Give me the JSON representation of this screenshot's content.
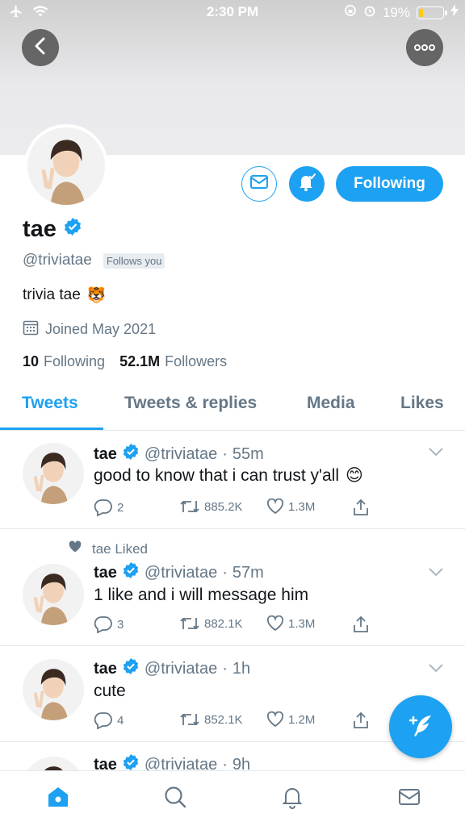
{
  "status_bar": {
    "time": "2:30 PM",
    "battery_percent": "19%",
    "battery_level": 0.19
  },
  "header": {
    "back_icon": "chevron-left-icon",
    "more_icon": "more-horizontal-icon"
  },
  "profile": {
    "name": "tae",
    "verified": true,
    "handle": "@triviatae",
    "follows_you": "Follows you",
    "bio": "trivia tae",
    "bio_emoji": "🐯",
    "joined": "Joined May 2021",
    "following_count": "10",
    "following_label": "Following",
    "followers_count": "52.1M",
    "followers_label": "Followers",
    "follow_button": "Following"
  },
  "tabs": [
    {
      "label": "Tweets",
      "active": true
    },
    {
      "label": "Tweets & replies",
      "active": false
    },
    {
      "label": "Media",
      "active": false
    },
    {
      "label": "Likes",
      "active": false
    }
  ],
  "tweets": [
    {
      "name": "tae",
      "handle": "@triviatae",
      "time": "55m",
      "text": "good to know that i can trust y'all",
      "emoji": "😊",
      "replies": "2",
      "retweets": "885.2K",
      "likes": "1.3M"
    },
    {
      "liked_by": "tae Liked",
      "name": "tae",
      "handle": "@triviatae",
      "time": "57m",
      "text": "1 like and i will message him",
      "replies": "3",
      "retweets": "882.1K",
      "likes": "1.3M"
    },
    {
      "name": "tae",
      "handle": "@triviatae",
      "time": "1h",
      "text": "cute",
      "replies": "4",
      "retweets": "852.1K",
      "likes": "1.2M"
    },
    {
      "name": "tae",
      "handle": "@triviatae",
      "time": "9h"
    }
  ],
  "colors": {
    "accent": "#1da1f2",
    "muted": "#657786",
    "text": "#14171a",
    "divider": "#e1e8ed"
  },
  "nav": [
    "home-icon",
    "search-icon",
    "notifications-icon",
    "messages-icon"
  ]
}
